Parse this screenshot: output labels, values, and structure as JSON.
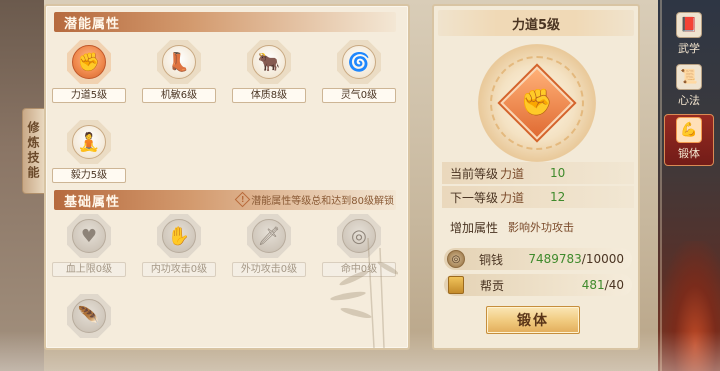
{
  "side_tab": {
    "label": "修炼技能"
  },
  "potential": {
    "title": "潜能属性",
    "skills": [
      {
        "label": "力道5级",
        "icon": "fist-icon",
        "glyph": "✊",
        "active": true
      },
      {
        "label": "机敏6级",
        "icon": "boot-icon",
        "glyph": "👢"
      },
      {
        "label": "体质8级",
        "icon": "ox-head-icon",
        "glyph": "🐂"
      },
      {
        "label": "灵气0级",
        "icon": "swirl-icon",
        "glyph": "🌀"
      },
      {
        "label": "毅力5级",
        "icon": "meditation-icon",
        "glyph": "🧘"
      }
    ]
  },
  "basic": {
    "title": "基础属性",
    "note": "潜能属性等级总和达到80级解锁",
    "note_icon": "!",
    "skills": [
      {
        "label": "血上限0级",
        "icon": "heart-hand-icon",
        "glyph": "♥"
      },
      {
        "label": "内功攻击0级",
        "icon": "palm-icon",
        "glyph": "✋"
      },
      {
        "label": "外功攻击0级",
        "icon": "sword-icon",
        "glyph": "🗡"
      },
      {
        "label": "命中0级",
        "icon": "target-icon",
        "glyph": "◎"
      },
      {
        "label": "",
        "icon": "feather-icon",
        "glyph": "🪶"
      }
    ]
  },
  "detail": {
    "title": "力道5级",
    "medal_icon": "fist-icon",
    "medal_glyph": "✊",
    "current": {
      "label": "当前等级",
      "name": "力道",
      "value": "10"
    },
    "next": {
      "label": "下一等级",
      "name": "力道",
      "value": "12"
    },
    "effect": {
      "label": "增加属性",
      "value": "影响外功攻击"
    },
    "costs": [
      {
        "icon": "copper-coin-icon",
        "name": "铜钱",
        "have": "7489783",
        "sep": "/",
        "need": "10000"
      },
      {
        "icon": "contribution-token-icon",
        "name": "帮贡",
        "have": "481",
        "sep": "/",
        "need": "40"
      }
    ],
    "button": "锻体"
  },
  "nav": [
    {
      "label": "武学",
      "icon": "book-icon",
      "glyph": "📕"
    },
    {
      "label": "心法",
      "icon": "scroll-icon",
      "glyph": "📜"
    },
    {
      "label": "锻体",
      "icon": "muscle-icon",
      "glyph": "💪",
      "active": true
    }
  ],
  "colors": {
    "accent": "#d4642c",
    "have_value": "#3f8a2c",
    "panel_bg": "#f5ecdc"
  }
}
